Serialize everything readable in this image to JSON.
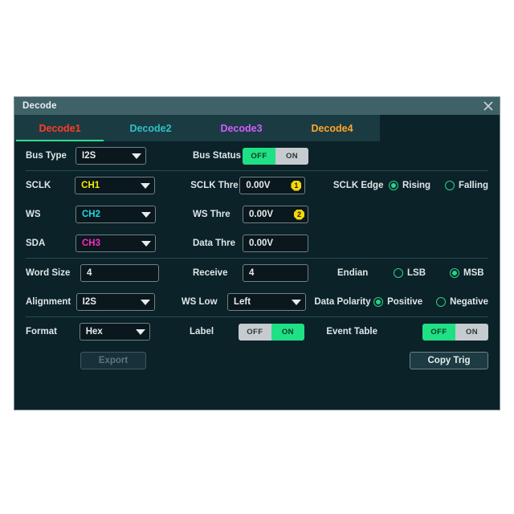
{
  "dialog": {
    "title": "Decode",
    "close_icon": "close-icon"
  },
  "tabs": [
    {
      "label": "Decode1",
      "color": "#ff3c28",
      "active": true
    },
    {
      "label": "Decode2",
      "color": "#2ac3c8",
      "active": false
    },
    {
      "label": "Decode3",
      "color": "#d45cff",
      "active": false
    },
    {
      "label": "Decode4",
      "color": "#ffa726",
      "active": false
    }
  ],
  "rows": {
    "bus_type": {
      "label": "Bus Type",
      "value": "I2S",
      "status_label": "Bus Status",
      "status_off": "OFF",
      "status_on": "ON",
      "status_selected": "OFF"
    },
    "sclk": {
      "label": "SCLK",
      "value": "CH1",
      "value_color": "#f5e90a",
      "thre_label": "SCLK Thre",
      "thre_value": "0.00V",
      "thre_badge": "1",
      "edge_label": "SCLK Edge",
      "edge_options": [
        "Rising",
        "Falling"
      ],
      "edge_selected": "Rising"
    },
    "ws": {
      "label": "WS",
      "value": "CH2",
      "value_color": "#18d9e8",
      "thre_label": "WS Thre",
      "thre_value": "0.00V",
      "thre_badge": "2"
    },
    "sda": {
      "label": "SDA",
      "value": "CH3",
      "value_color": "#ff28c8",
      "thre_label": "Data Thre",
      "thre_value": "0.00V"
    },
    "word_size": {
      "label": "Word Size",
      "value": "4",
      "receive_label": "Receive",
      "receive_value": "4",
      "endian_label": "Endian",
      "endian_options": [
        "LSB",
        "MSB"
      ],
      "endian_selected": "MSB"
    },
    "alignment": {
      "label": "Alignment",
      "value": "I2S",
      "wslow_label": "WS Low",
      "wslow_value": "Left",
      "polarity_label": "Data Polarity",
      "polarity_options": [
        "Positive",
        "Negative"
      ],
      "polarity_selected": "Positive"
    },
    "format": {
      "label": "Format",
      "value": "Hex",
      "label_label": "Label",
      "label_off": "OFF",
      "label_on": "ON",
      "label_selected": "ON",
      "event_table_label": "Event Table",
      "event_table_off": "OFF",
      "event_table_on": "ON",
      "event_table_selected": "OFF"
    },
    "buttons": {
      "export_label": "Export",
      "export_enabled": false,
      "copy_trig_label": "Copy Trig",
      "copy_trig_enabled": true
    }
  },
  "colors": {
    "accent_green": "#1fe085",
    "dialog_bg": "#0b2229",
    "titlebar_bg": "#3f6168",
    "tabbar_bg": "#1b3b42",
    "field_bg": "#0a171c",
    "border": "#6f8288",
    "badge_yellow": "#f7d70b"
  }
}
